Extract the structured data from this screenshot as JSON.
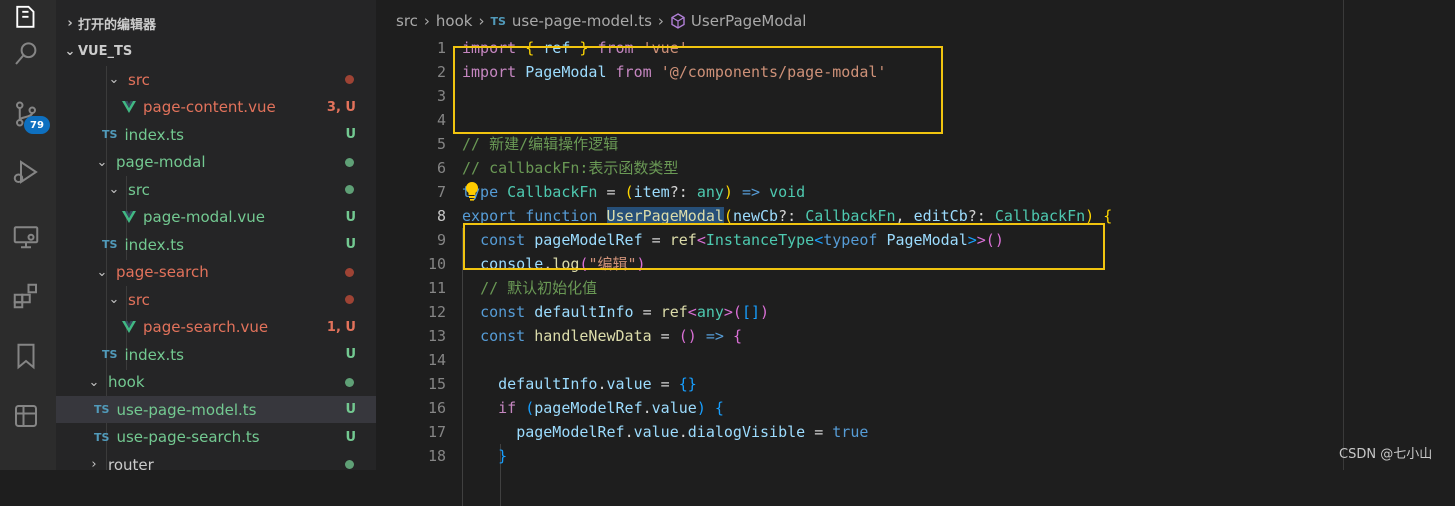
{
  "activity_bar": {
    "icons": [
      "explorer-icon",
      "search-icon",
      "source-control-icon",
      "run-debug-icon",
      "remote-explorer-icon",
      "extensions-icon",
      "bookmarks-icon",
      "database-icon"
    ],
    "scm_badge": "79"
  },
  "sidebar": {
    "open_editors_label": "打开的编辑器",
    "project_label": "VUE_TS",
    "rows": [
      {
        "label": "src",
        "kind": "folder",
        "expanded": true,
        "status": "",
        "dot": "#c74e39",
        "color": "#e2725b"
      },
      {
        "label": "page-content.vue",
        "kind": "vue",
        "status": "3, U",
        "color": "#e2725b"
      },
      {
        "label": "index.ts",
        "kind": "ts",
        "status": "U",
        "color": "#73c991"
      },
      {
        "label": "page-modal",
        "kind": "folder",
        "expanded": true,
        "status": "",
        "dot": "#73c991",
        "color": "#73c991"
      },
      {
        "label": "src",
        "kind": "folder",
        "expanded": true,
        "status": "",
        "dot": "#73c991",
        "color": "#73c991"
      },
      {
        "label": "page-modal.vue",
        "kind": "vue",
        "status": "U",
        "color": "#73c991"
      },
      {
        "label": "index.ts",
        "kind": "ts",
        "status": "U",
        "color": "#73c991"
      },
      {
        "label": "page-search",
        "kind": "folder",
        "expanded": true,
        "status": "",
        "dot": "#c74e39",
        "color": "#e2725b"
      },
      {
        "label": "src",
        "kind": "folder",
        "expanded": true,
        "status": "",
        "dot": "#c74e39",
        "color": "#e2725b"
      },
      {
        "label": "page-search.vue",
        "kind": "vue",
        "status": "1, U",
        "color": "#e2725b"
      },
      {
        "label": "index.ts",
        "kind": "ts",
        "status": "U",
        "color": "#73c991"
      },
      {
        "label": "hook",
        "kind": "folder",
        "expanded": true,
        "status": "",
        "dot": "#73c991",
        "color": "#73c991"
      },
      {
        "label": "use-page-model.ts",
        "kind": "ts",
        "status": "U",
        "color": "#73c991",
        "selected": true
      },
      {
        "label": "use-page-search.ts",
        "kind": "ts",
        "status": "U",
        "color": "#73c991"
      },
      {
        "label": "router",
        "kind": "folder",
        "expanded": false,
        "status": "",
        "dot": "#73c991",
        "color": "#cccccc"
      }
    ]
  },
  "breadcrumb": {
    "parts": [
      "src",
      "hook"
    ],
    "file_badge": "TS",
    "file": "use-page-model.ts",
    "symbol": "UserPageModal"
  },
  "editor": {
    "line_numbers": [
      "1",
      "2",
      "3",
      "4",
      "5",
      "6",
      "7",
      "8",
      "9",
      "10",
      "11",
      "12",
      "13",
      "14",
      "15",
      "16",
      "17",
      "18"
    ],
    "active_line": "8"
  },
  "watermark": "CSDN @七小山",
  "colors": {
    "highlight_box": "#f1c40f",
    "modified": "#e2725b",
    "untracked": "#73c991",
    "accent": "#0e70c0"
  }
}
